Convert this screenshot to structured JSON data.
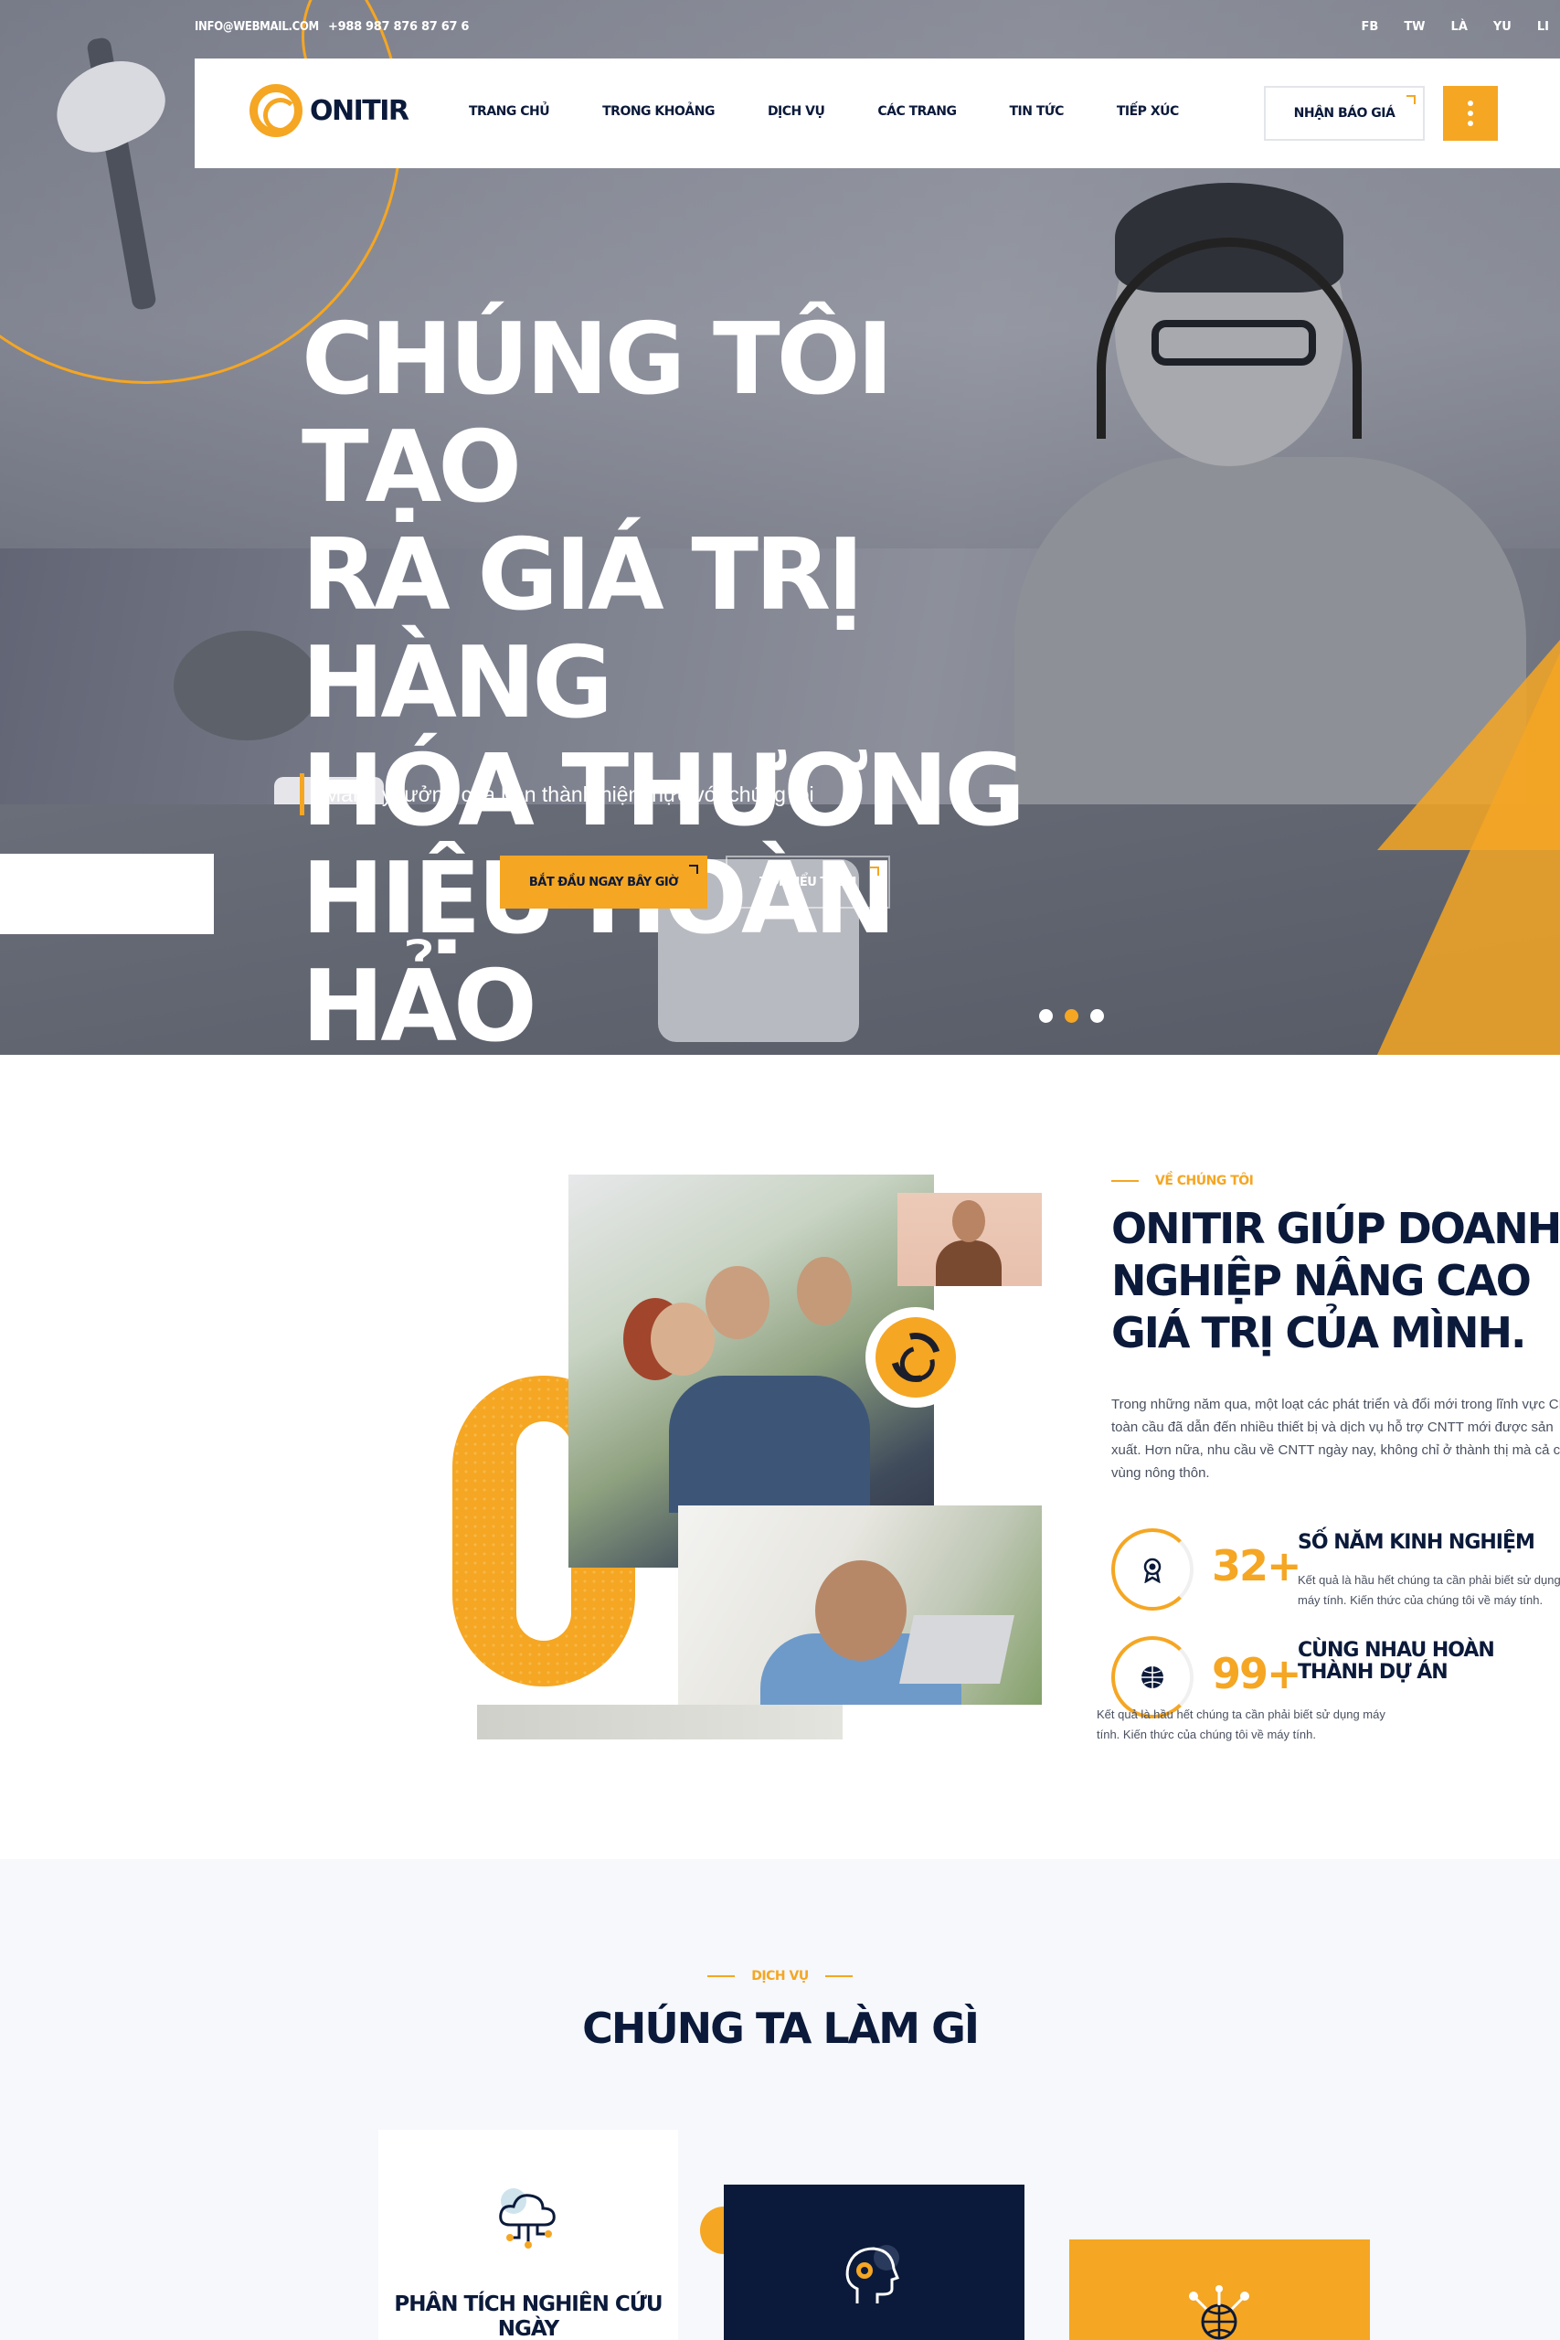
{
  "topbar": {
    "email": "INFO@WEBMAIL.COM",
    "phone": "+988 987 876 87 67 6",
    "socials": [
      "FB",
      "TW",
      "LÀ",
      "YU",
      "LI"
    ]
  },
  "brand": {
    "name": "ONITIR"
  },
  "nav": {
    "items": [
      "TRANG CHỦ",
      "TRONG KHOẢNG",
      "DỊCH VỤ",
      "CÁC TRANG",
      "TIN TỨC",
      "TIẾP XÚC"
    ],
    "quote_button": "NHẬN BÁO GIÁ"
  },
  "hero": {
    "title_lines": [
      "CHÚNG TÔI TẠO",
      "RA GIÁ TRỊ HÀNG",
      "HÓA THƯƠNG",
      "HIỆU HOÀN HẢO"
    ],
    "subtitle": "Mang ý tưởng của bạn thành hiện thực với chúng tôi",
    "primary_button": "BẮT ĐẦU NGAY BÂY GIỜ",
    "secondary_button": "TÌM HIỂU THÊM",
    "slides_total": 3,
    "active_slide": 2
  },
  "about": {
    "tag": "VỀ CHÚNG TÔI",
    "title": "ONITIR GIÚP DOANH NGHIỆP NÂNG CAO GIÁ TRỊ CỦA MÌNH.",
    "text": "Trong những năm qua, một loạt các phát triển và đổi mới trong lĩnh vực CNTT toàn cầu đã dẫn đến nhiều thiết bị và dịch vụ hỗ trợ CNTT mới được sản xuất. Hơn nữa, nhu cầu về CNTT ngày nay, không chỉ ở thành thị mà cả các vùng nông thôn.",
    "big_letter": "O",
    "stats": [
      {
        "icon": "award-icon",
        "number": "32+",
        "label": "SỐ NĂM KINH NGHIỆM",
        "desc": "Kết quả là hầu hết chúng ta cần phải biết sử dụng máy tính. Kiến thức của chúng tôi về máy tính."
      },
      {
        "icon": "globe-icon",
        "number": "99+",
        "label": "CÙNG NHAU HOÀN THÀNH DỰ ÁN",
        "desc": "Kết quả là hầu hết chúng ta cần phải biết sử dụng máy tính. Kiến thức của chúng tôi về máy tính."
      }
    ]
  },
  "services": {
    "tag": "DỊCH VỤ",
    "title": "CHÚNG TA LÀM GÌ",
    "cards": [
      {
        "icon": "cloud-network-icon",
        "title": "PHÂN TÍCH NGHIÊN CỨU NGÀY"
      },
      {
        "icon": "ai-head-icon",
        "title": ""
      },
      {
        "icon": "globe-network-icon",
        "title": ""
      }
    ]
  },
  "colors": {
    "accent": "#f5a623",
    "navy": "#0b1a3a",
    "light_bg": "#f6f8fb"
  }
}
